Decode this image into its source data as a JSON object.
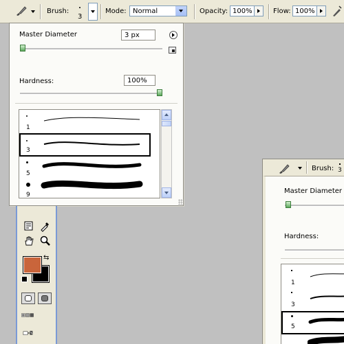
{
  "options_bar": {
    "tool_icon": "paintbrush-icon",
    "brush_label": "Brush:",
    "brush_size": "3",
    "mode_label": "Mode:",
    "mode_value": "Normal",
    "opacity_label": "Opacity:",
    "opacity_value": "100%",
    "flow_label": "Flow:",
    "flow_value": "100%",
    "airbrush_icon": "airbrush-icon"
  },
  "brush_popup": {
    "master_diameter_label": "Master Diameter",
    "master_diameter_value": "3 px",
    "master_diameter_slider_fraction": 0.0,
    "hardness_label": "Hardness:",
    "hardness_value": "100%",
    "hardness_slider_fraction": 1.0,
    "menu_icon": "flyout-arrow-icon",
    "new_preset_icon": "new-preset-icon",
    "brushes": [
      {
        "size": "1",
        "selected": false
      },
      {
        "size": "3",
        "selected": true
      },
      {
        "size": "5",
        "selected": false
      },
      {
        "size": "9",
        "selected": false
      }
    ]
  },
  "toolbox": {
    "foreground_color": "#c9653b",
    "background_color": "#000000",
    "tools": [
      "notes-icon",
      "eyedropper-icon",
      "hand-icon",
      "zoom-icon",
      "standard-mode-icon",
      "quickmask-mode-icon",
      "screen-mode-icon",
      "jump-to-imageready-icon"
    ]
  },
  "second_window": {
    "brush_label": "Brush:",
    "brush_size": "3",
    "master_diameter_label": "Master Diameter",
    "hardness_label": "Hardness:",
    "brushes": [
      {
        "size": "1"
      },
      {
        "size": "3"
      },
      {
        "size": "5"
      }
    ]
  }
}
